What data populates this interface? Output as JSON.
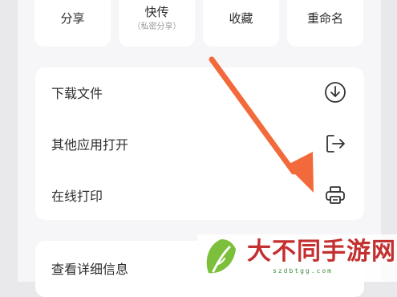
{
  "share_tiles": [
    {
      "label": "分享",
      "sub": "",
      "icon": "share-icon"
    },
    {
      "label": "快传",
      "sub": "（私密分享）",
      "icon": "quick-send-icon"
    },
    {
      "label": "收藏",
      "sub": "",
      "icon": "favorite-icon"
    },
    {
      "label": "重命名",
      "sub": "",
      "icon": "rename-icon"
    }
  ],
  "menu": {
    "download": {
      "label": "下载文件",
      "icon": "download-icon"
    },
    "open_with": {
      "label": "其他应用打开",
      "icon": "open-external-icon"
    },
    "print": {
      "label": "在线打印",
      "icon": "printer-icon"
    },
    "details": {
      "label": "查看详细信息"
    }
  },
  "annotation": {
    "color": "#f26a3b",
    "icon": "pointer-arrow"
  },
  "watermark": {
    "title": "大不同手游网",
    "domain": "szdbtgg.com",
    "logo": "leaf-logo",
    "title_color": "#c42f2f",
    "leaf_color": "#7bbf3a"
  }
}
